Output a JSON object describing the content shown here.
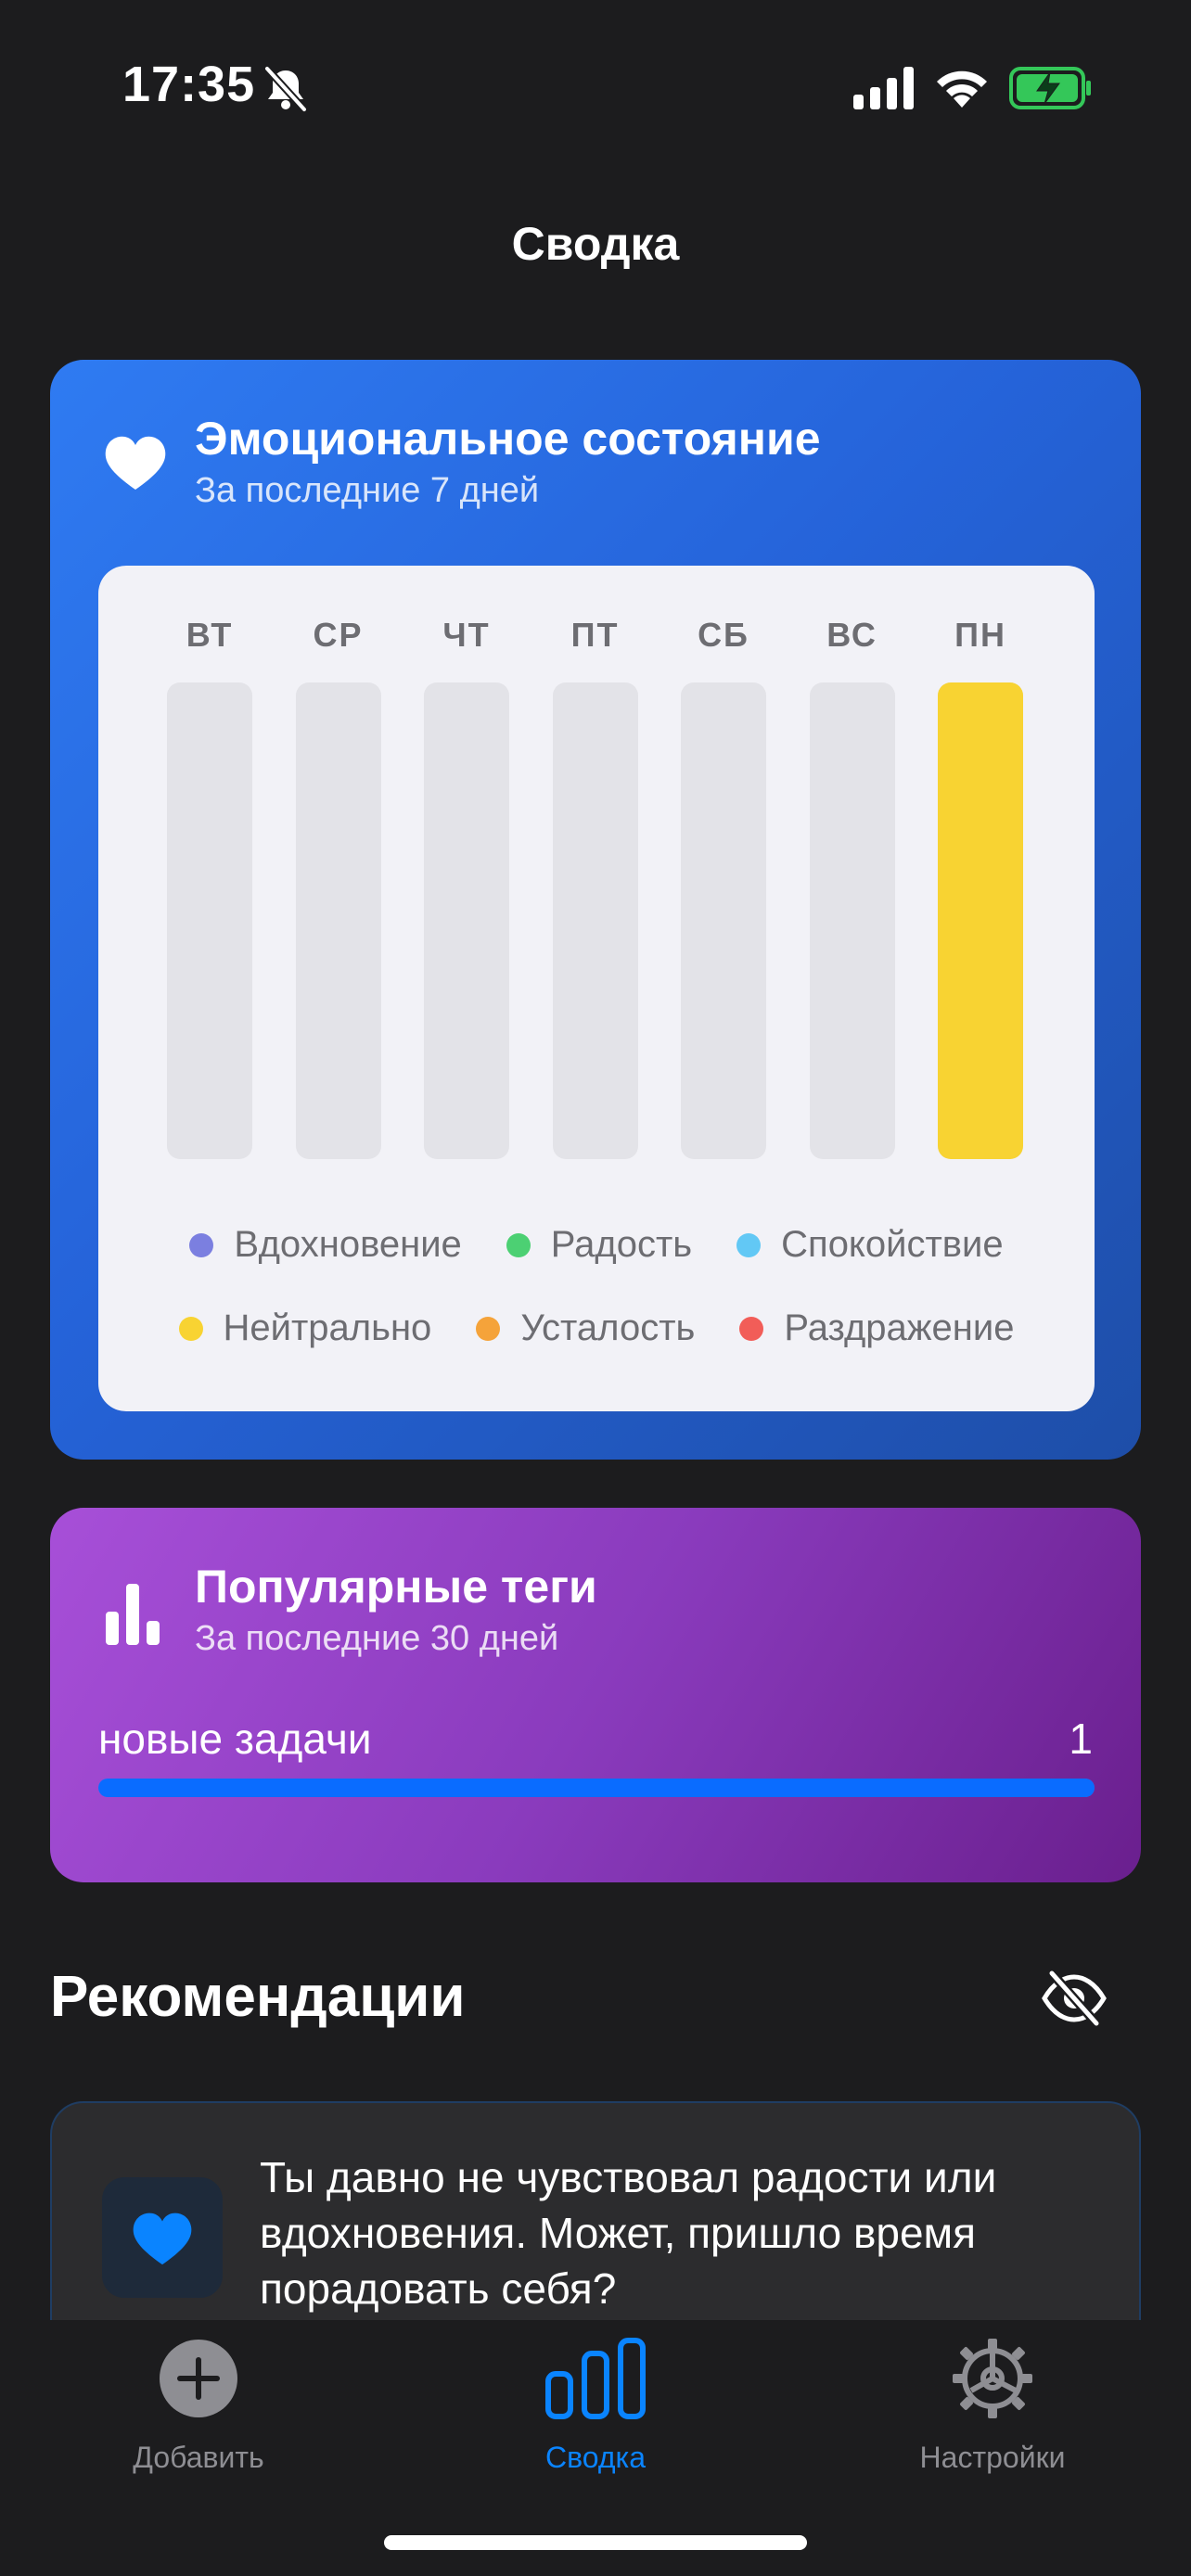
{
  "status_bar": {
    "time": "17:35",
    "icons": [
      "bell-slash-icon",
      "cellular-signal-icon",
      "wifi-icon",
      "battery-charging-icon"
    ]
  },
  "nav": {
    "title": "Сводка"
  },
  "emotion_card": {
    "title": "Эмоциональное состояние",
    "subtitle": "За последние 7 дней",
    "icon": "heart-icon",
    "gradient_start": "#2f7bf2",
    "gradient_end": "#1e4ea8",
    "days": [
      {
        "label": "ВТ",
        "fill": 0,
        "color": ""
      },
      {
        "label": "СР",
        "fill": 0,
        "color": ""
      },
      {
        "label": "ЧТ",
        "fill": 0,
        "color": ""
      },
      {
        "label": "ПТ",
        "fill": 0,
        "color": ""
      },
      {
        "label": "СБ",
        "fill": 0,
        "color": ""
      },
      {
        "label": "ВС",
        "fill": 0,
        "color": ""
      },
      {
        "label": "ПН",
        "fill": 1.0,
        "color": "#f8d332"
      }
    ],
    "legend": [
      {
        "label": "Вдохновение",
        "color": "#7b7fe0"
      },
      {
        "label": "Радость",
        "color": "#4cd073"
      },
      {
        "label": "Спокойствие",
        "color": "#62c8f5"
      },
      {
        "label": "Нейтрально",
        "color": "#f8d332"
      },
      {
        "label": "Усталость",
        "color": "#f5a33a"
      },
      {
        "label": "Раздражение",
        "color": "#f25d58"
      }
    ]
  },
  "tags_card": {
    "title": "Популярные теги",
    "subtitle": "За последние 30 дней",
    "icon": "bar-chart-icon",
    "tags": [
      {
        "name": "новые задачи",
        "count": "1",
        "fraction": 1.0
      }
    ]
  },
  "recommendations": {
    "title": "Рекомендации",
    "hide_icon": "eye-slash-icon",
    "items": [
      {
        "icon": "heart-icon",
        "text": "Ты давно не чувствовал радости или вдохновения. Может, пришло время порадовать себя?"
      }
    ]
  },
  "tab_bar": {
    "tabs": [
      {
        "label": "Добавить",
        "icon": "plus-circle-icon",
        "active": false
      },
      {
        "label": "Сводка",
        "icon": "bar-chart-icon",
        "active": true
      },
      {
        "label": "Настройки",
        "icon": "gear-icon",
        "active": false
      }
    ],
    "accent": "#0a84ff",
    "inactive": "#8e8e93"
  }
}
